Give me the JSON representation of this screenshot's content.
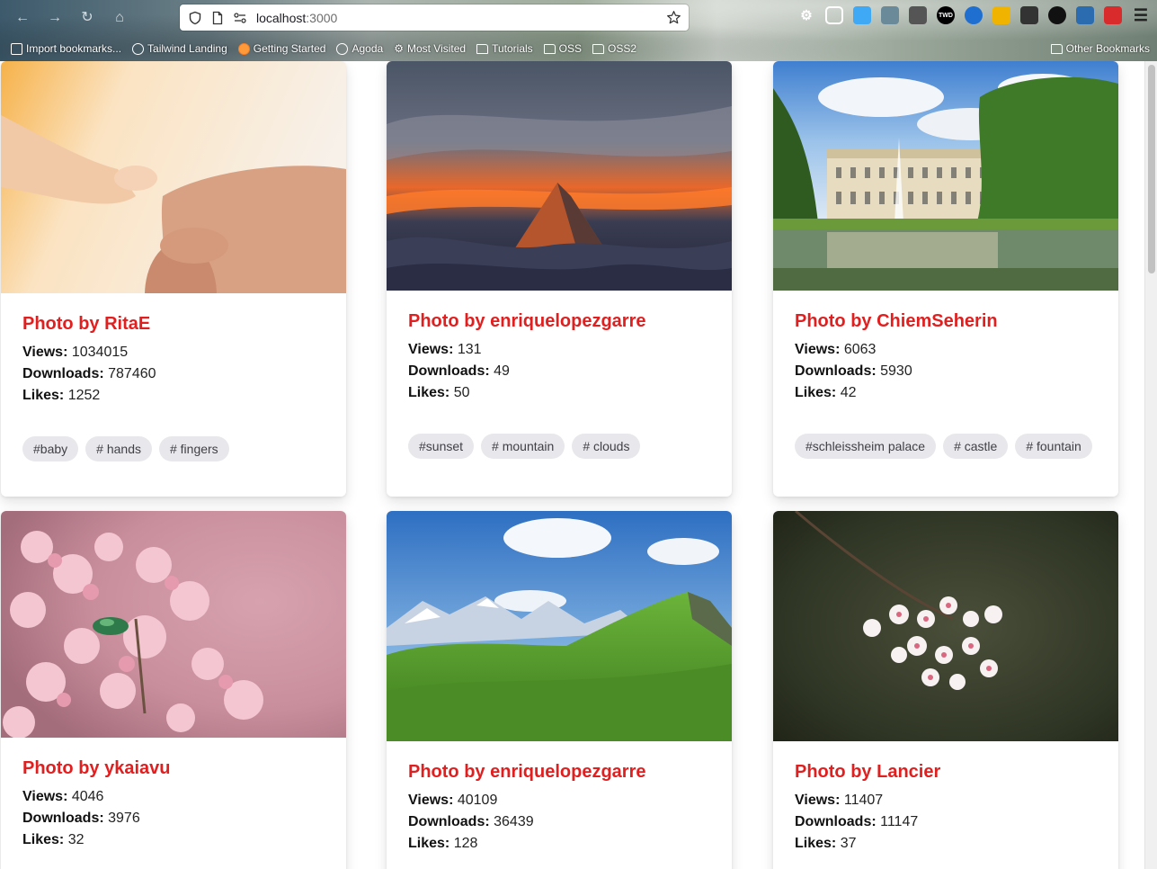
{
  "browser": {
    "url_host": "localhost",
    "url_port": ":3000",
    "bookmarks": [
      {
        "label": "Import bookmarks...",
        "icon": "import-icon"
      },
      {
        "label": "Tailwind Landing",
        "icon": "globe-icon"
      },
      {
        "label": "Getting Started",
        "icon": "firefox-icon"
      },
      {
        "label": "Agoda",
        "icon": "globe-icon"
      },
      {
        "label": "Most Visited",
        "icon": "gear-icon"
      },
      {
        "label": "Tutorials",
        "icon": "folder-icon"
      },
      {
        "label": "OSS",
        "icon": "folder-icon"
      },
      {
        "label": "OSS2",
        "icon": "folder-icon"
      }
    ],
    "other_bookmarks": "Other Bookmarks"
  },
  "labels": {
    "views": "Views:",
    "downloads": "Downloads:",
    "likes": "Likes:"
  },
  "cards": [
    {
      "title": "Photo by RitaE",
      "views": "1034015",
      "downloads": "787460",
      "likes": "1252",
      "tags": [
        "#baby",
        "# hands",
        "# fingers"
      ],
      "image": "baby-hand-photo"
    },
    {
      "title": "Photo by enriquelopezgarre",
      "views": "131",
      "downloads": "49",
      "likes": "50",
      "tags": [
        "#sunset",
        "# mountain",
        "# clouds"
      ],
      "image": "mountain-sunset-photo"
    },
    {
      "title": "Photo by ChiemSeherin",
      "views": "6063",
      "downloads": "5930",
      "likes": "42",
      "tags": [
        "#schleissheim palace",
        "# castle",
        "# fountain"
      ],
      "image": "palace-fountain-photo"
    },
    {
      "title": "Photo by ykaiavu",
      "views": "4046",
      "downloads": "3976",
      "likes": "32",
      "tags": [],
      "image": "pink-flowers-beetle-photo"
    },
    {
      "title": "Photo by enriquelopezgarre",
      "views": "40109",
      "downloads": "36439",
      "likes": "128",
      "tags": [],
      "image": "alpine-meadow-photo"
    },
    {
      "title": "Photo by Lancier",
      "views": "11407",
      "downloads": "11147",
      "likes": "37",
      "tags": [],
      "image": "cherry-blossom-photo"
    }
  ]
}
